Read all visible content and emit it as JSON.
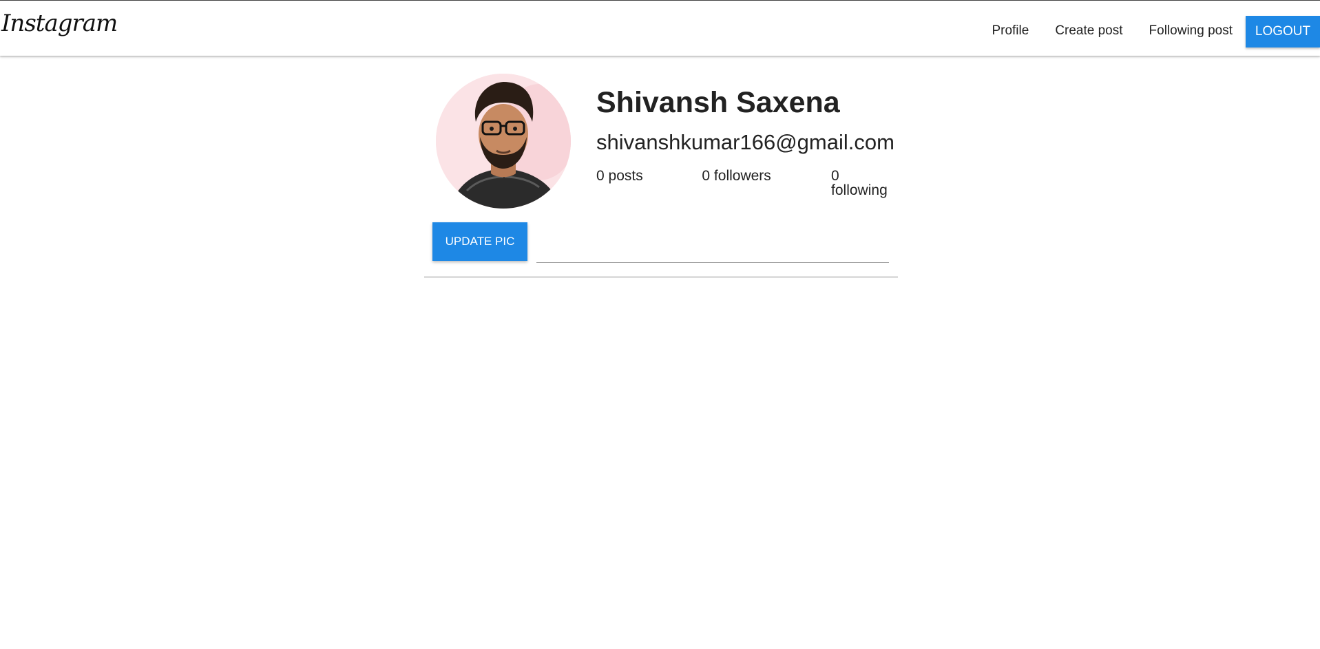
{
  "navbar": {
    "brand": "Instagram",
    "links": [
      "Profile",
      "Create post",
      "Following post"
    ],
    "logout_label": "LOGOUT",
    "logout_color": "#1e88e5"
  },
  "profile": {
    "name": "Shivansh Saxena",
    "email": "shivanshkumar166@gmail.com",
    "stats": {
      "posts": "0 posts",
      "followers": "0 followers",
      "following": "0 following"
    },
    "avatar_icon": "user-photo",
    "update_pic_label": "UPDATE PIC",
    "file_path_value": ""
  }
}
